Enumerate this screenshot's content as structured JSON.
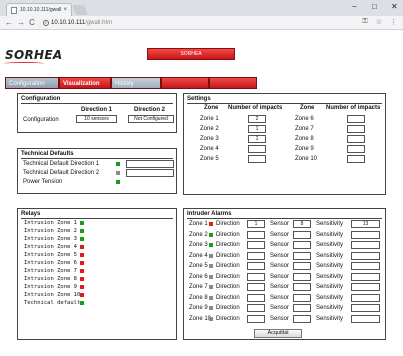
{
  "browser": {
    "tab_title": "10.10.10.111/gwall.htm",
    "tab_close": "×",
    "url_main": "10.10.10.111",
    "url_path": "/gwall.htm",
    "back": "←",
    "forward": "→",
    "reload": "C",
    "minimize": "−",
    "maximize": "□",
    "close": "✕",
    "key_icon": "⚿",
    "star_icon": "☆",
    "menu_icon": "⋮"
  },
  "logo": {
    "text": "SORHEA"
  },
  "brand_bar": {
    "text": "SORHEA"
  },
  "nav": {
    "configuration": "Configuration",
    "visualization": "Visualization",
    "history": "History"
  },
  "configuration": {
    "title": "Configuration",
    "dir1_header": "Direction 1",
    "dir2_header": "Direction 2",
    "row_label": "Configuration",
    "dir1_value": "10 sensors",
    "dir2_value": "Not Configured"
  },
  "settings": {
    "title": "Settings",
    "zone_header": "Zone",
    "impacts_header": "Number of impacts",
    "zones_left": [
      {
        "label": "Zone 1",
        "value": "2"
      },
      {
        "label": "Zone 2",
        "value": "1"
      },
      {
        "label": "Zone 3",
        "value": "1"
      },
      {
        "label": "Zone 4",
        "value": ""
      },
      {
        "label": "Zone 5",
        "value": ""
      }
    ],
    "zones_right": [
      {
        "label": "Zone 6",
        "value": ""
      },
      {
        "label": "Zone 7",
        "value": ""
      },
      {
        "label": "Zone 8",
        "value": ""
      },
      {
        "label": "Zone 9",
        "value": ""
      },
      {
        "label": "Zone 10",
        "value": ""
      }
    ]
  },
  "technical_defaults": {
    "title": "Technical Defaults",
    "rows": [
      {
        "label": "Technical Default Direction 1",
        "status": "green"
      },
      {
        "label": "Technical Default Direction 2",
        "status": "gray"
      },
      {
        "label": "Power Tension",
        "status": "green"
      }
    ]
  },
  "relays": {
    "title": "Relays",
    "rows": [
      {
        "label": "Intrusion Zone 1",
        "status": "green"
      },
      {
        "label": "Intrusion Zone 2",
        "status": "green"
      },
      {
        "label": "Intrusion Zone 3",
        "status": "green"
      },
      {
        "label": "Intrusion Zone 4",
        "status": "red"
      },
      {
        "label": "Intrusion Zone 5",
        "status": "red"
      },
      {
        "label": "Intrusion Zone 6",
        "status": "red"
      },
      {
        "label": "Intrusion Zone 7",
        "status": "red"
      },
      {
        "label": "Intrusion Zone 8",
        "status": "red"
      },
      {
        "label": "Intrusion Zone 9",
        "status": "red"
      },
      {
        "label": "Intrusion Zone 10",
        "status": "red"
      },
      {
        "label": "Technical default",
        "status": "green"
      }
    ]
  },
  "intruder_alarms": {
    "title": "Intruder Alarms",
    "direction_label": "Direction",
    "sensor_label": "Sensor",
    "sensitivity_label": "Sensitivity",
    "rows": [
      {
        "zone": "Zone 1",
        "status": "red",
        "direction": "1",
        "sensor": "8",
        "sensitivity": "13"
      },
      {
        "zone": "Zone 2",
        "status": "green",
        "direction": "",
        "sensor": "",
        "sensitivity": ""
      },
      {
        "zone": "Zone 3",
        "status": "green",
        "direction": "",
        "sensor": "",
        "sensitivity": ""
      },
      {
        "zone": "Zone 4",
        "status": "gray",
        "direction": "",
        "sensor": "",
        "sensitivity": ""
      },
      {
        "zone": "Zone 5",
        "status": "gray",
        "direction": "",
        "sensor": "",
        "sensitivity": ""
      },
      {
        "zone": "Zone 6",
        "status": "gray",
        "direction": "",
        "sensor": "",
        "sensitivity": ""
      },
      {
        "zone": "Zone 7",
        "status": "gray",
        "direction": "",
        "sensor": "",
        "sensitivity": ""
      },
      {
        "zone": "Zone 8",
        "status": "gray",
        "direction": "",
        "sensor": "",
        "sensitivity": ""
      },
      {
        "zone": "Zone 9",
        "status": "gray",
        "direction": "",
        "sensor": "",
        "sensitivity": ""
      },
      {
        "zone": "Zone 10",
        "status": "gray",
        "direction": "",
        "sensor": "",
        "sensitivity": ""
      }
    ],
    "acquit_label": "Acquittal"
  },
  "colors": {
    "green": "#1a9e1a",
    "red": "#e01b1b",
    "gray": "#8a8a8a",
    "brand": "#d92024"
  }
}
